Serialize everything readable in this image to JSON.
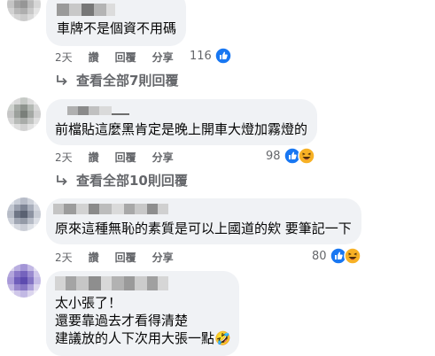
{
  "comments": [
    {
      "text_lines": [
        "車牌不是個資不用碼"
      ],
      "time": "2天",
      "like_label": "讚",
      "reply_label": "回覆",
      "share_label": "分享",
      "reaction_count": "116",
      "reactions": [
        "like-icon"
      ],
      "view_replies": "查看全部7則回覆"
    },
    {
      "text_lines": [
        "前檔貼這麼黑肯定是晚上開車大燈加霧燈的"
      ],
      "time": "2天",
      "like_label": "讚",
      "reply_label": "回覆",
      "share_label": "分享",
      "reaction_count": "98",
      "reactions": [
        "like-icon",
        "haha-icon"
      ],
      "view_replies": "查看全部10則回覆"
    },
    {
      "text_lines": [
        "原來這種無恥的素質是可以上國道的欸 要筆記一下"
      ],
      "time": "2天",
      "like_label": "讚",
      "reply_label": "回覆",
      "share_label": "分享",
      "reaction_count": "80",
      "reactions": [
        "like-icon",
        "haha-icon"
      ]
    },
    {
      "text_lines": [
        "太小張了！",
        "還要靠過去才看得清楚",
        "建議放的人下次用大張一點🤣"
      ]
    }
  ],
  "colors": {
    "bubble": "#f0f2f5",
    "secondary_text": "#65676b",
    "like_blue": "#1877f2",
    "haha_yellow": "#f7b125"
  }
}
